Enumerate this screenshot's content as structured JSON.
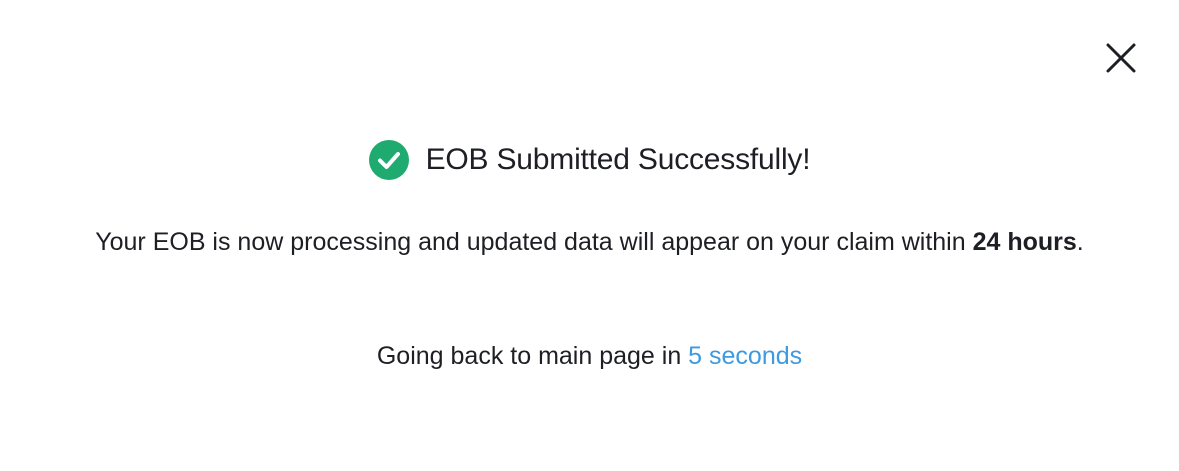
{
  "dialog": {
    "close_icon": "close-icon",
    "success_icon": "check-circle-icon",
    "title": "EOB Submitted Successfully!",
    "message_prefix": "Your EOB is now processing and updated data will appear on your claim within ",
    "message_bold": "24 hours",
    "message_suffix": ".",
    "redirect_prefix": "Going back to main page in ",
    "redirect_countdown": "5 seconds"
  },
  "colors": {
    "success": "#1fab6f",
    "countdown": "#3d9ae0",
    "text": "#1e1f24"
  }
}
